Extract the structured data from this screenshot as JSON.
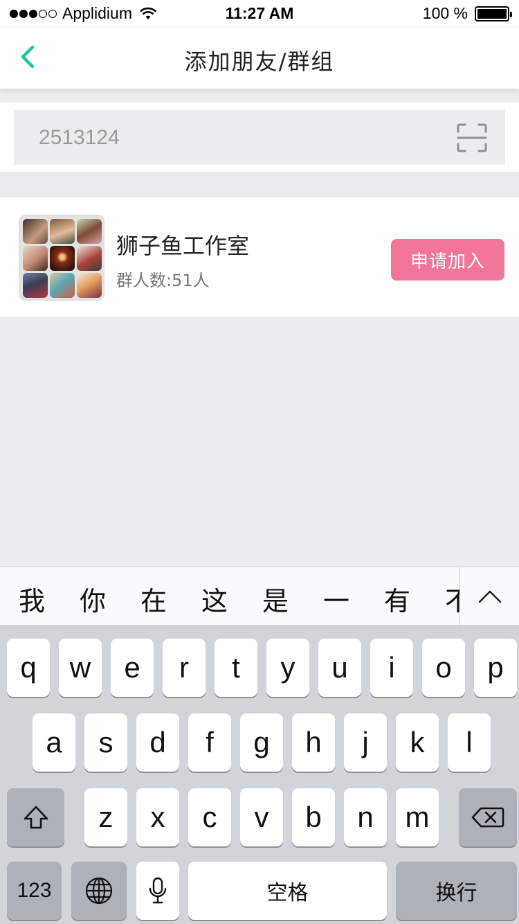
{
  "status_bar": {
    "carrier": "Applidium",
    "time": "11:27 AM",
    "battery": "100 %"
  },
  "nav": {
    "title": "添加朋友/群组"
  },
  "search": {
    "value": "2513124"
  },
  "group": {
    "name": "狮子鱼工作室",
    "count_label": "群人数:",
    "count_value": "51人",
    "join_label": "申请加入"
  },
  "candidates": [
    "我",
    "你",
    "在",
    "这",
    "是",
    "一",
    "有",
    "不"
  ],
  "keyboard": {
    "row1": [
      "q",
      "w",
      "e",
      "r",
      "t",
      "y",
      "u",
      "i",
      "o",
      "p"
    ],
    "row2": [
      "a",
      "s",
      "d",
      "f",
      "g",
      "h",
      "j",
      "k",
      "l"
    ],
    "row3": [
      "z",
      "x",
      "c",
      "v",
      "b",
      "n",
      "m"
    ],
    "numbers_label": "123",
    "space_label": "空格",
    "return_label": "换行"
  },
  "colors": {
    "accent_green": "#1fc9a0",
    "join_pink": "#f2769a",
    "page_bg": "#ebecee"
  },
  "icons": [
    "signal-icon",
    "wifi-icon",
    "battery-icon",
    "back-chevron-icon",
    "scan-icon",
    "chevron-up-icon",
    "shift-icon",
    "backspace-icon",
    "globe-icon",
    "microphone-icon"
  ]
}
